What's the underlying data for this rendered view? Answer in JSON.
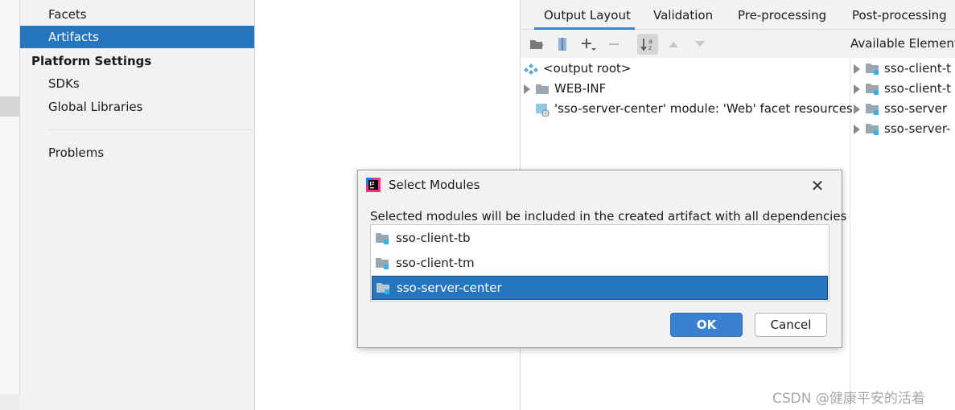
{
  "sidebar": {
    "items": [
      {
        "label": "Facets",
        "selected": false
      },
      {
        "label": "Artifacts",
        "selected": true
      }
    ],
    "platform_heading": "Platform Settings",
    "platform_items": [
      "SDKs",
      "Global Libraries"
    ],
    "problems_label": "Problems"
  },
  "tabs": [
    "Output Layout",
    "Validation",
    "Pre-processing",
    "Post-processing"
  ],
  "active_tab": "Output Layout",
  "available_heading": "Available Element",
  "output_tree": {
    "root": "<output root>",
    "web_inf": "WEB-INF",
    "facet_resources": "'sso-server-center' module: 'Web' facet resources"
  },
  "available_items": [
    "sso-client-t",
    "sso-client-t",
    "sso-server",
    "sso-server-"
  ],
  "dialog": {
    "title": "Select Modules",
    "description": "Selected modules will be included in the created artifact with all dependencies",
    "modules": [
      {
        "label": "sso-client-tb",
        "selected": false
      },
      {
        "label": "sso-client-tm",
        "selected": false
      },
      {
        "label": "sso-server-center",
        "selected": true
      }
    ],
    "ok_label": "OK",
    "cancel_label": "Cancel",
    "close_glyph": "✕"
  },
  "watermark": "CSDN @健康平安的活着",
  "colors": {
    "selection": "#2675bf",
    "ok_button": "#3a81d1"
  }
}
